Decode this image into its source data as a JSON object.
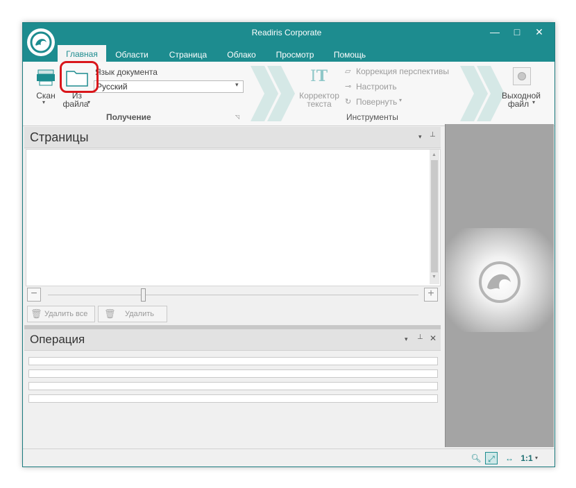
{
  "window": {
    "title": "Readiris Corporate"
  },
  "window_controls": [
    "—",
    "□",
    "✕"
  ],
  "tabs": [
    {
      "label": "Главная",
      "active": true
    },
    {
      "label": "Области"
    },
    {
      "label": "Страница"
    },
    {
      "label": "Облако"
    },
    {
      "label": "Просмотр"
    },
    {
      "label": "Помощь"
    }
  ],
  "ribbon": {
    "scan_label": "Скан",
    "from_file_label_1": "Из",
    "from_file_label_2": "файла",
    "doc_language_label": "Язык документа",
    "doc_language_value": "Русский",
    "group_acquire": "Получение",
    "text_corrector_1": "Корректор",
    "text_corrector_2": "текста",
    "perspective": "Коррекция перспективы",
    "configure": "Настроить",
    "rotate": "Повернуть",
    "group_tools": "Инструменты",
    "output_file_1": "Выходной",
    "output_file_2": "файл"
  },
  "pages_panel": {
    "title": "Страницы",
    "delete_all": "Удалить все",
    "delete": "Удалить"
  },
  "ops_panel": {
    "title": "Операция"
  },
  "statusbar": {
    "zoom_label": "1:1"
  },
  "colors": {
    "accent": "#1d8c8f",
    "highlight": "#d9161b"
  }
}
